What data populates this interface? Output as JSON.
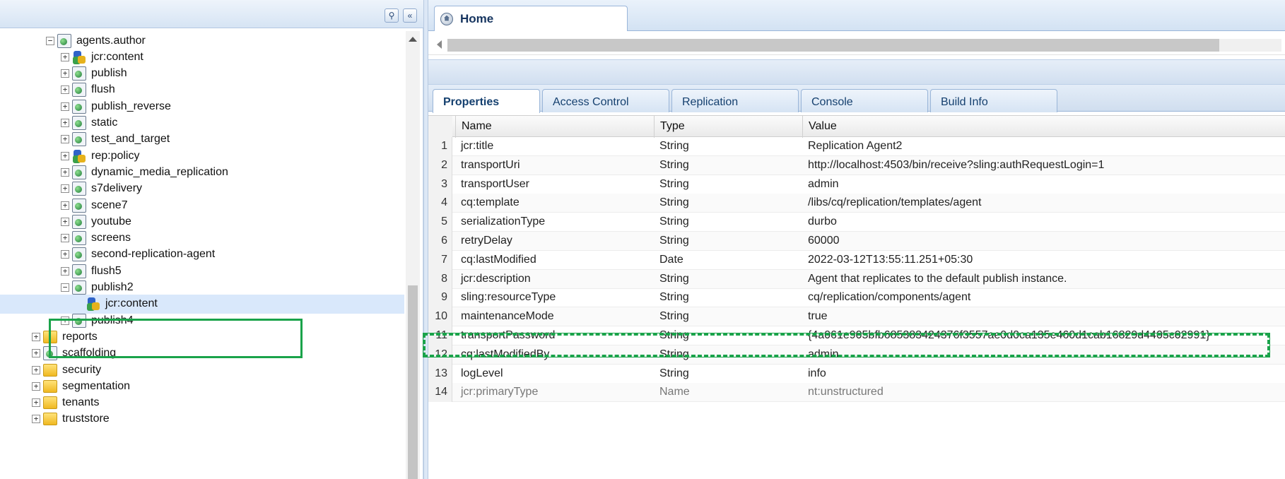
{
  "left_panel": {
    "tree": [
      {
        "label": "agents.author",
        "icon": "page",
        "expander": "minus",
        "depth": 0
      },
      {
        "label": "jcr:content",
        "icon": "node",
        "expander": "plus",
        "depth": 1
      },
      {
        "label": "publish",
        "icon": "page",
        "expander": "plus",
        "depth": 1
      },
      {
        "label": "flush",
        "icon": "page",
        "expander": "plus",
        "depth": 1
      },
      {
        "label": "publish_reverse",
        "icon": "page",
        "expander": "plus",
        "depth": 1
      },
      {
        "label": "static",
        "icon": "page",
        "expander": "plus",
        "depth": 1
      },
      {
        "label": "test_and_target",
        "icon": "page",
        "expander": "plus",
        "depth": 1
      },
      {
        "label": "rep:policy",
        "icon": "node",
        "expander": "plus",
        "depth": 1
      },
      {
        "label": "dynamic_media_replication",
        "icon": "page",
        "expander": "plus",
        "depth": 1
      },
      {
        "label": "s7delivery",
        "icon": "page",
        "expander": "plus",
        "depth": 1
      },
      {
        "label": "scene7",
        "icon": "page",
        "expander": "plus",
        "depth": 1
      },
      {
        "label": "youtube",
        "icon": "page",
        "expander": "plus",
        "depth": 1
      },
      {
        "label": "screens",
        "icon": "page",
        "expander": "plus",
        "depth": 1
      },
      {
        "label": "second-replication-agent",
        "icon": "page",
        "expander": "plus",
        "depth": 1
      },
      {
        "label": "flush5",
        "icon": "page",
        "expander": "plus",
        "depth": 1
      },
      {
        "label": "publish2",
        "icon": "page",
        "expander": "minus",
        "depth": 1
      },
      {
        "label": "jcr:content",
        "icon": "node",
        "expander": "none",
        "depth": 2,
        "selected": true
      },
      {
        "label": "publish4",
        "icon": "page",
        "expander": "plus",
        "depth": 1
      },
      {
        "label": "reports",
        "icon": "folder",
        "expander": "plus",
        "depth": -1
      },
      {
        "label": "scaffolding",
        "icon": "page",
        "expander": "plus",
        "depth": -1
      },
      {
        "label": "security",
        "icon": "folder",
        "expander": "plus",
        "depth": -1
      },
      {
        "label": "segmentation",
        "icon": "folder",
        "expander": "plus",
        "depth": -1
      },
      {
        "label": "tenants",
        "icon": "folder",
        "expander": "plus",
        "depth": -1
      },
      {
        "label": "truststore",
        "icon": "folder",
        "expander": "plus",
        "depth": -1
      }
    ]
  },
  "right_panel": {
    "home_tab": "Home",
    "subtabs": [
      "Properties",
      "Access Control",
      "Replication",
      "Console",
      "Build Info"
    ],
    "grid": {
      "headers": {
        "name": "Name",
        "type": "Type",
        "value": "Value"
      },
      "rows": [
        {
          "n": "1",
          "name": "jcr:title",
          "type": "String",
          "value": "Replication Agent2"
        },
        {
          "n": "2",
          "name": "transportUri",
          "type": "String",
          "value": "http://localhost:4503/bin/receive?sling:authRequestLogin=1"
        },
        {
          "n": "3",
          "name": "transportUser",
          "type": "String",
          "value": "admin"
        },
        {
          "n": "4",
          "name": "cq:template",
          "type": "String",
          "value": "/libs/cq/replication/templates/agent"
        },
        {
          "n": "5",
          "name": "serializationType",
          "type": "String",
          "value": "durbo"
        },
        {
          "n": "6",
          "name": "retryDelay",
          "type": "String",
          "value": "60000"
        },
        {
          "n": "7",
          "name": "cq:lastModified",
          "type": "Date",
          "value": "2022-03-12T13:55:11.251+05:30"
        },
        {
          "n": "8",
          "name": "jcr:description",
          "type": "String",
          "value": "Agent that replicates to the default publish instance."
        },
        {
          "n": "9",
          "name": "sling:resourceType",
          "type": "String",
          "value": "cq/replication/components/agent"
        },
        {
          "n": "10",
          "name": "maintenanceMode",
          "type": "String",
          "value": "true"
        },
        {
          "n": "11",
          "name": "transportPassword",
          "type": "String",
          "value": "{4a061e905bfb685383424376f3557ae0d0ca135e460d1cab16829d4405c02991}"
        },
        {
          "n": "12",
          "name": "cq:lastModifiedBy",
          "type": "String",
          "value": "admin"
        },
        {
          "n": "13",
          "name": "logLevel",
          "type": "String",
          "value": "info"
        },
        {
          "n": "14",
          "name": "jcr:primaryType",
          "type": "Name",
          "value": "nt:unstructured",
          "dim": true
        }
      ]
    }
  },
  "colors": {
    "highlight": "#1aa34a",
    "selected_bg": "#d9e8fb",
    "tab_text": "#15406f"
  }
}
